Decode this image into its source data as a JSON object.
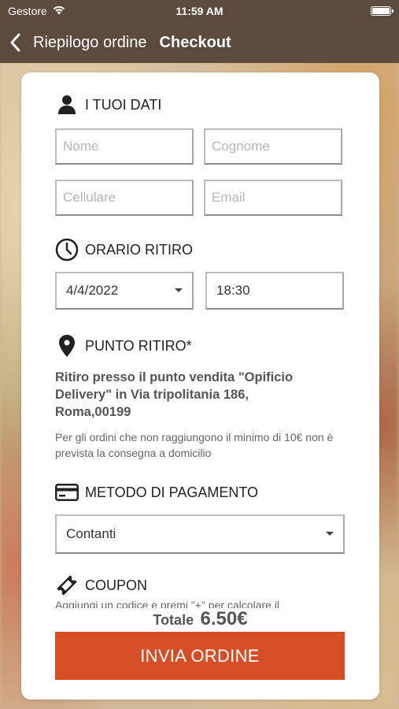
{
  "status_bar": {
    "carrier": "Gestore",
    "time": "11:59 AM"
  },
  "nav": {
    "back_label": "Riepilogo ordine",
    "title": "Checkout"
  },
  "personal": {
    "title": "I TUOI DATI",
    "first_name_placeholder": "Nome",
    "last_name_placeholder": "Cognome",
    "phone_placeholder": "Cellulare",
    "email_placeholder": "Email"
  },
  "pickup_time": {
    "title": "ORARIO RITIRO",
    "date": "4/4/2022",
    "time": "18:30"
  },
  "pickup_point": {
    "title": "PUNTO RITIRO*",
    "address": "Ritiro presso il punto vendita \"Opificio Delivery\" in Via tripolitania 186, Roma,00199",
    "note": "Per gli ordini che non raggiungono il minimo di 10€ non è prevista la consegna a domicilio"
  },
  "payment": {
    "title": "METODO DI PAGAMENTO",
    "selected": "Contanti"
  },
  "coupon": {
    "title": "COUPON",
    "hint": "Aggiungi un codice e premi \"+\" per calcolare il"
  },
  "footer": {
    "total_label": "Totale",
    "total_amount": "6.50€",
    "submit_label": "INVIA ORDINE"
  },
  "colors": {
    "nav_bg": "#5c4a3e",
    "accent": "#d64e25"
  }
}
